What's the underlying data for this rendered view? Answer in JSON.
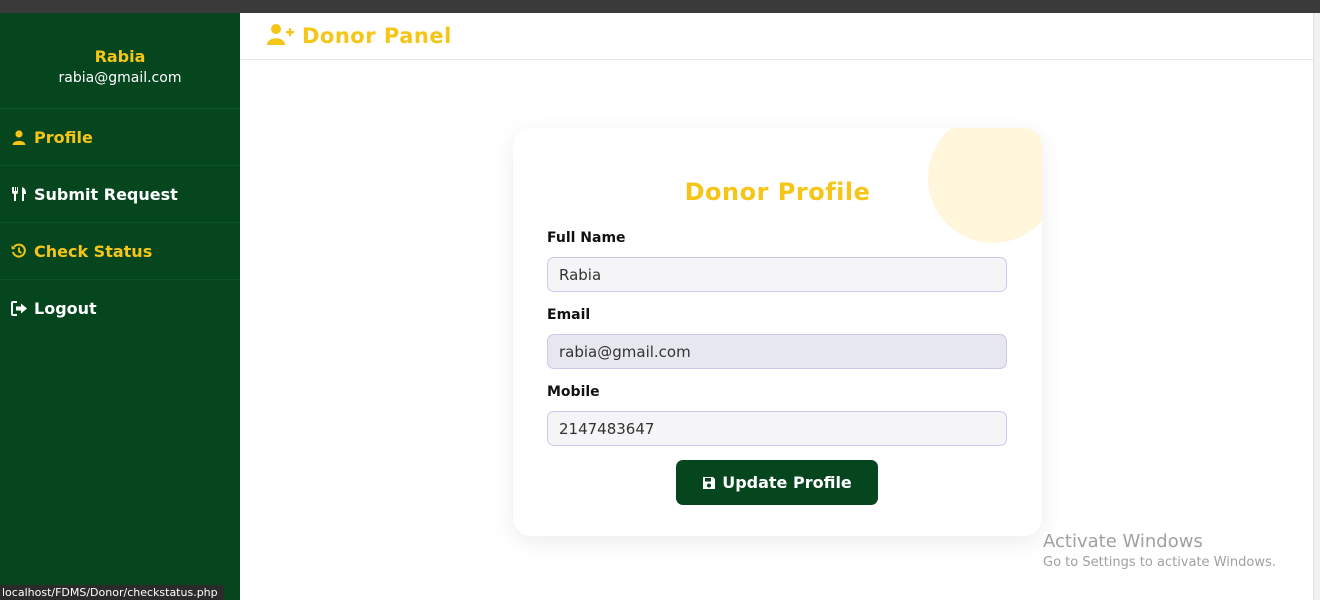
{
  "sidebar": {
    "user_name": "Rabia",
    "user_email": "rabia@gmail.com",
    "items": [
      {
        "label": "Profile",
        "icon": "user-icon"
      },
      {
        "label": "Submit Request",
        "icon": "utensils-icon"
      },
      {
        "label": "Check Status",
        "icon": "history-icon"
      },
      {
        "label": "Logout",
        "icon": "logout-icon"
      }
    ]
  },
  "header": {
    "title": "Donor Panel",
    "icon": "user-plus-icon"
  },
  "profile_card": {
    "title": "Donor Profile",
    "full_name_label": "Full Name",
    "full_name_value": "Rabia",
    "email_label": "Email",
    "email_value": "rabia@gmail.com",
    "mobile_label": "Mobile",
    "mobile_value": "2147483647",
    "update_button_label": "Update Profile",
    "update_button_icon": "save-icon"
  },
  "watermark": {
    "title": "Activate Windows",
    "subtitle": "Go to Settings to activate Windows."
  },
  "status_bar": {
    "url": "localhost/FDMS/Donor/checkstatus.php"
  },
  "colors": {
    "sidebar_bg": "#06461f",
    "accent_yellow": "#f5c518",
    "button_bg": "#06461f"
  }
}
